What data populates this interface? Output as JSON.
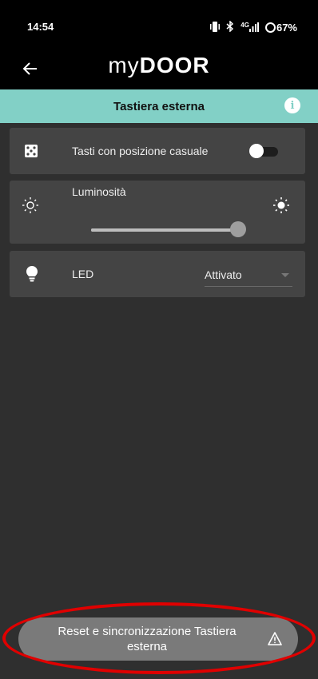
{
  "status_bar": {
    "time": "14:54",
    "signal": "4G",
    "battery": "67%"
  },
  "app": {
    "logo_my": "my",
    "logo_door": "DOOR"
  },
  "page": {
    "title": "Tastiera esterna",
    "info_glyph": "i"
  },
  "settings": {
    "random_keys": {
      "label": "Tasti con posizione casuale",
      "enabled": false,
      "icon": "dice-icon"
    },
    "brightness": {
      "label": "Luminosità",
      "value_fraction": 0.97,
      "icon_low": "sun-low-icon",
      "icon_high": "sun-high-icon"
    },
    "led": {
      "label": "LED",
      "selected": "Attivato",
      "icon": "bulb-icon"
    }
  },
  "actions": {
    "reset_label": "Reset e sincronizzazione Tastiera esterna",
    "warn_icon": "warning-icon"
  },
  "colors": {
    "accent": "#82d0c6",
    "background": "#2f2f2f",
    "card": "#444444",
    "highlight": "#e00000"
  }
}
